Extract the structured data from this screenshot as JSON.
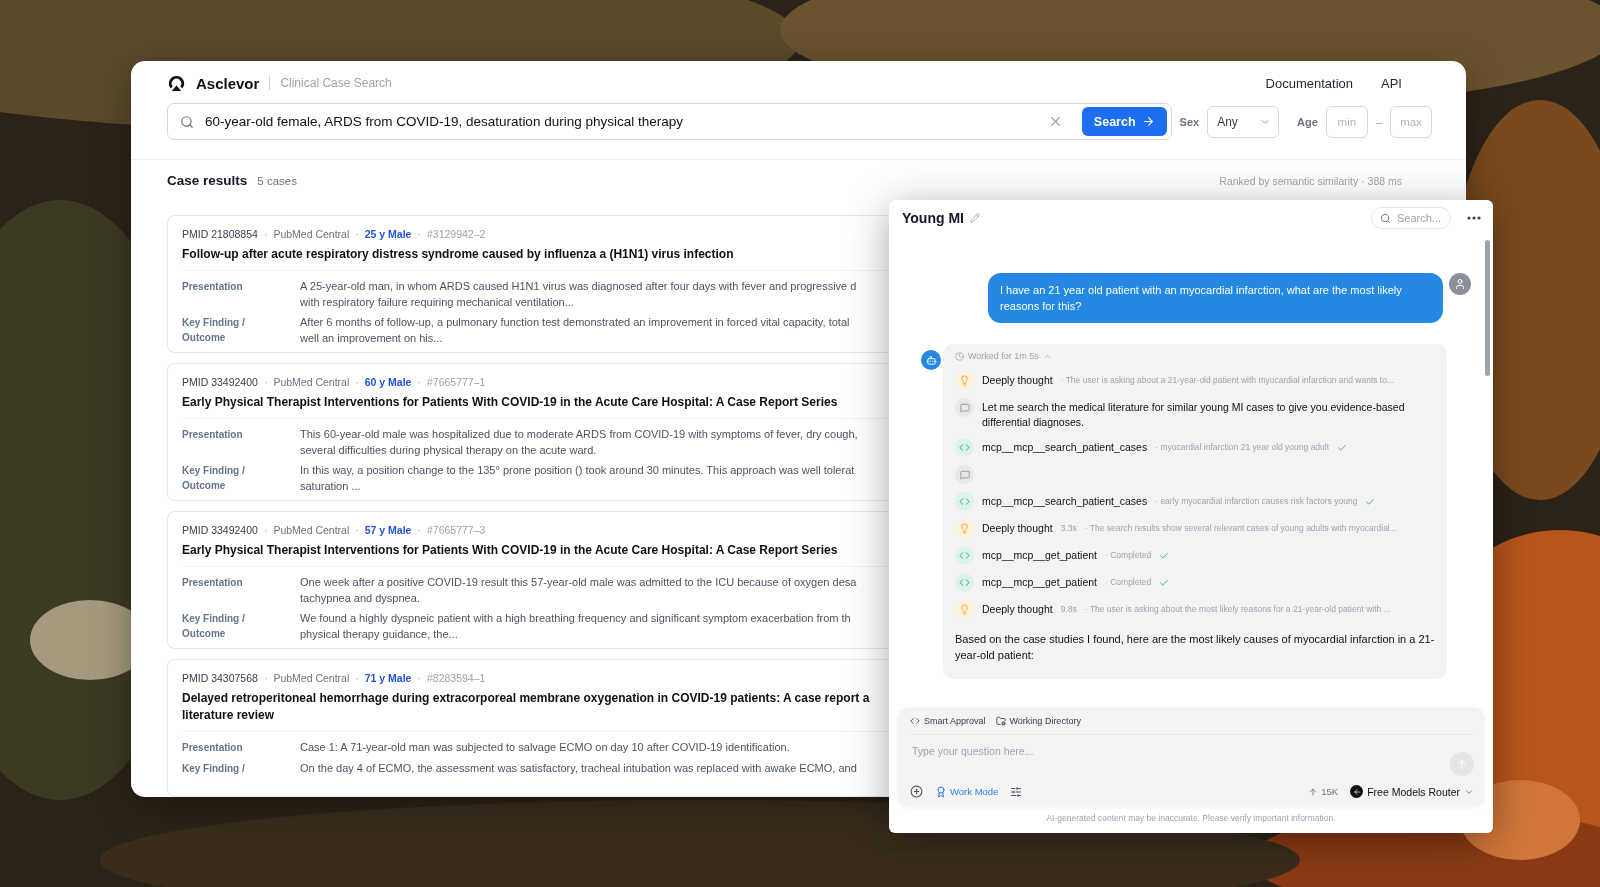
{
  "header": {
    "brand": "Asclevor",
    "subtitle": "Clinical Case Search",
    "nav": [
      "Documentation",
      "API"
    ]
  },
  "search": {
    "value": "60-year-old female, ARDS from COVID-19, desaturation during physical therapy",
    "button": "Search",
    "sex_label": "Sex",
    "sex_value": "Any",
    "age_label": "Age",
    "age_min_placeholder": "min",
    "age_separator": "–",
    "age_max_placeholder": "max"
  },
  "results": {
    "title": "Case results",
    "count": "5 cases",
    "ranking": "Ranked by semantic similarity · 388 ms",
    "cases": [
      {
        "meta": [
          {
            "kind": "id",
            "text": "PMID 21808854"
          },
          {
            "kind": "sep",
            "text": "·"
          },
          {
            "kind": "source",
            "text": "PubMed Central"
          },
          {
            "kind": "sep",
            "text": "·"
          },
          {
            "kind": "patient",
            "text": "25 y Male"
          },
          {
            "kind": "sep",
            "text": "·"
          },
          {
            "kind": "ref",
            "text": "#3129942–2"
          }
        ],
        "title": "Follow-up after acute respiratory distress syndrome caused by influenza a (H1N1) virus infection",
        "fields": [
          {
            "label": "Presentation",
            "text": "A 25-year-old man, in whom ARDS caused H1N1 virus was diagnosed after four days with fever and progressive d\nwith respiratory failure requiring mechanical ventilation..."
          },
          {
            "label": "Key Finding /\nOutcome",
            "text": "After 6 months of follow-up, a pulmonary function test demonstrated an improvement in forced vital capacity, total\nwell an improvement on his..."
          }
        ]
      },
      {
        "meta": [
          {
            "kind": "id",
            "text": "PMID 33492400"
          },
          {
            "kind": "sep",
            "text": "·"
          },
          {
            "kind": "source",
            "text": "PubMed Central"
          },
          {
            "kind": "sep",
            "text": "·"
          },
          {
            "kind": "patient",
            "text": "60 y Male"
          },
          {
            "kind": "sep",
            "text": "·"
          },
          {
            "kind": "ref",
            "text": "#7665777–1"
          }
        ],
        "title": "Early Physical Therapist Interventions for Patients With COVID-19 in the Acute Care Hospital: A Case Report Series",
        "fields": [
          {
            "label": "Presentation",
            "text": "This 60-year-old male was hospitalized due to moderate ARDS from COVID-19 with symptoms of fever, dry cough,\nseveral difficulties during physical therapy on the acute ward."
          },
          {
            "label": "Key Finding /\nOutcome",
            "text": "In this way, a position change to the 135° prone position () took around 30 minutes. This approach was well tolerat\nsaturation ..."
          }
        ]
      },
      {
        "meta": [
          {
            "kind": "id",
            "text": "PMID 33492400"
          },
          {
            "kind": "sep",
            "text": "·"
          },
          {
            "kind": "source",
            "text": "PubMed Central"
          },
          {
            "kind": "sep",
            "text": "·"
          },
          {
            "kind": "patient",
            "text": "57 y Male"
          },
          {
            "kind": "sep",
            "text": "·"
          },
          {
            "kind": "ref",
            "text": "#7665777–3"
          }
        ],
        "title": "Early Physical Therapist Interventions for Patients With COVID-19 in the Acute Care Hospital: A Case Report Series",
        "fields": [
          {
            "label": "Presentation",
            "text": "One week after a positive COVID-19 result this 57-year-old male was admitted to the ICU because of oxygen desa\ntachypnea and dyspnea."
          },
          {
            "label": "Key Finding /\nOutcome",
            "text": "We found a highly dyspneic patient with a high breathing frequency and significant symptom exacerbation from th\nphysical therapy guidance, the..."
          }
        ]
      },
      {
        "meta": [
          {
            "kind": "id",
            "text": "PMID 34307568"
          },
          {
            "kind": "sep",
            "text": "·"
          },
          {
            "kind": "source",
            "text": "PubMed Central"
          },
          {
            "kind": "sep",
            "text": "·"
          },
          {
            "kind": "patient",
            "text": "71 y Male"
          },
          {
            "kind": "sep",
            "text": "·"
          },
          {
            "kind": "ref",
            "text": "#8283594–1"
          }
        ],
        "title": "Delayed retroperitoneal hemorrhage during extracorporeal membrane oxygenation in COVID-19 patients: A case report a\nliterature review",
        "fields": [
          {
            "label": "Presentation",
            "text": "Case 1: A 71-year-old man was subjected to salvage ECMO on day 10 after COVID-19 identification."
          },
          {
            "label": "Key Finding /",
            "text": "On the day 4 of ECMO, the assessment was satisfactory, tracheal intubation was replaced with awake ECMO, and"
          }
        ]
      }
    ]
  },
  "chat": {
    "title": "Young MI",
    "search_placeholder": "Search...",
    "user_message": "I have an 21 year old patient with an myocardial infarction, what are the most likely reasons for this?",
    "work": {
      "label": "Worked for 1m 5s",
      "expanded": true,
      "steps": [
        {
          "kind": "thought",
          "title": "Deeply thought",
          "detail": "· The user is asking about a 21-year-old patient with myocardial infarction and wants to..."
        },
        {
          "kind": "message",
          "text": "Let me search the medical literature for similar young MI cases to give you evidence-based differential diagnoses."
        },
        {
          "kind": "tool",
          "title": "mcp__mcp__search_patient_cases",
          "detail": "· myocardial infarction 21 year old young adult",
          "done": true
        },
        {
          "kind": "message"
        },
        {
          "kind": "tool",
          "title": "mcp__mcp__search_patient_cases",
          "detail": "· early myocardial infarction causes risk factors young",
          "done": true
        },
        {
          "kind": "thought",
          "title": "Deeply thought",
          "duration": "3.3s",
          "detail": "· The search results show several relevant cases of young adults with myocardial..."
        },
        {
          "kind": "tool",
          "title": "mcp__mcp__get_patient",
          "detail": "· Completed",
          "done": true
        },
        {
          "kind": "tool",
          "title": "mcp__mcp__get_patient",
          "detail": "· Completed",
          "done": true
        },
        {
          "kind": "thought",
          "title": "Deeply thought",
          "duration": "9.8s",
          "detail": "· The user is asking about the most likely reasons for a 21-year-old patient with ..."
        }
      ],
      "answer": "Based on the case studies I found, here are the most likely causes of myocardial infarction in a 21-year-old patient:"
    },
    "composer": {
      "chips": [
        {
          "kind": "approval",
          "label": "Smart Approval"
        },
        {
          "kind": "directory",
          "label": "Working Directory"
        }
      ],
      "placeholder": "Type your question here...",
      "work_mode": {
        "label": "Work Mode",
        "on": true
      },
      "tokens": "15K",
      "model": "Free Models Router"
    },
    "disclaimer": "AI-generated content may be inaccurate. Please verify important information."
  }
}
